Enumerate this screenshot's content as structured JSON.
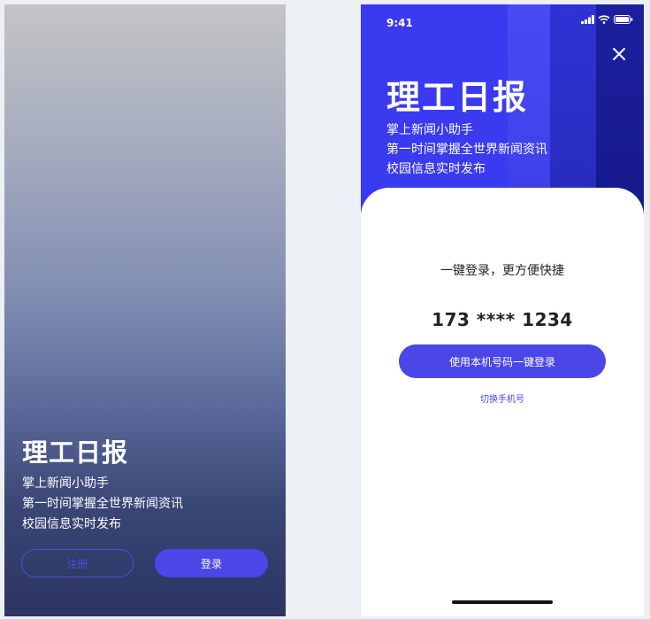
{
  "left_screen": {
    "title": "理工日报",
    "subtitle_lines": [
      "掌上新闻小助手",
      "第一时间掌握全世界新闻资讯",
      "校园信息实时发布"
    ],
    "register_label": "注册",
    "login_label": "登录"
  },
  "right_screen": {
    "status_time": "9:41",
    "status_icons": [
      "signal-icon",
      "wifi-icon",
      "battery-icon"
    ],
    "title": "理工日报",
    "subtitle_lines": [
      "掌上新闻小助手",
      "第一时间掌握全世界新闻资讯",
      "校园信息实时发布"
    ],
    "card_heading": "一键登录，更方便快捷",
    "phone_number": "173 **** 1234",
    "one_key_login_label": "使用本机号码一键登录",
    "switch_number_label": "切换手机号"
  },
  "colors": {
    "accent": "#4b46e8",
    "hero_blue": "#3a3af0",
    "dark_navy": "#2c3462"
  }
}
